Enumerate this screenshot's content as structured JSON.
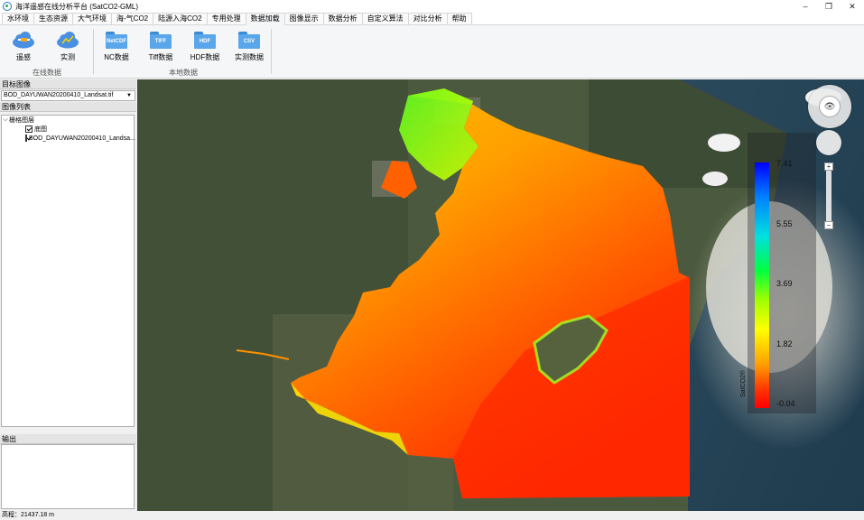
{
  "window": {
    "title": "海洋遥感在线分析平台 (SatCO2-GML)",
    "minimize": "–",
    "restore": "❐",
    "close": "✕"
  },
  "tabs": [
    {
      "label": "水环境",
      "active": false
    },
    {
      "label": "生态资源",
      "active": false
    },
    {
      "label": "大气环境",
      "active": false
    },
    {
      "label": "海-气CO2",
      "active": false
    },
    {
      "label": "陆源入海CO2",
      "active": false
    },
    {
      "label": "专用处理",
      "active": false
    },
    {
      "label": "数据加载",
      "active": true
    },
    {
      "label": "图像显示",
      "active": false
    },
    {
      "label": "数据分析",
      "active": false
    },
    {
      "label": "自定义算法",
      "active": false
    },
    {
      "label": "对比分析",
      "active": false
    },
    {
      "label": "帮助",
      "active": false
    }
  ],
  "ribbon": {
    "online_group": "在线数据",
    "local_group": "本地数据",
    "buttons": [
      {
        "label": "遥感",
        "icon": "cloud-satellite-icon"
      },
      {
        "label": "实测",
        "icon": "cloud-chart-icon"
      },
      {
        "label": "NC数据",
        "icon": "netcdf-folder-icon",
        "badge": "NetCDF"
      },
      {
        "label": "Tiff数据",
        "icon": "tiff-folder-icon",
        "badge": "TIFF"
      },
      {
        "label": "HDF数据",
        "icon": "hdf-folder-icon",
        "badge": "HDF"
      },
      {
        "label": "实测数据",
        "icon": "csv-folder-icon",
        "badge": "CSV"
      }
    ]
  },
  "left_panel": {
    "target_image_label": "目标图像",
    "target_image_value": "BOD_DAYUWAN20200410_Landsat.tif",
    "image_list_label": "图像列表",
    "tree": {
      "root": "栅格图层",
      "children": [
        {
          "label": "底图",
          "checked": true
        },
        {
          "label": "BOD_DAYUWAN20200410_Landsa...",
          "checked": true
        }
      ]
    },
    "output_label": "输出"
  },
  "status": {
    "elevation": "高程：21437.18 m"
  },
  "legend": {
    "title": "SatCO2®",
    "labels": [
      "7.41",
      "5.55",
      "3.69",
      "1.82",
      "-0.04"
    ],
    "colors": [
      "#0000ff",
      "#00e0e0",
      "#00ff40",
      "#ffff00",
      "#ff0000"
    ]
  },
  "map_controls": {
    "compass_icon": "eye-icon",
    "zoom_in": "+",
    "zoom_out": "−"
  }
}
